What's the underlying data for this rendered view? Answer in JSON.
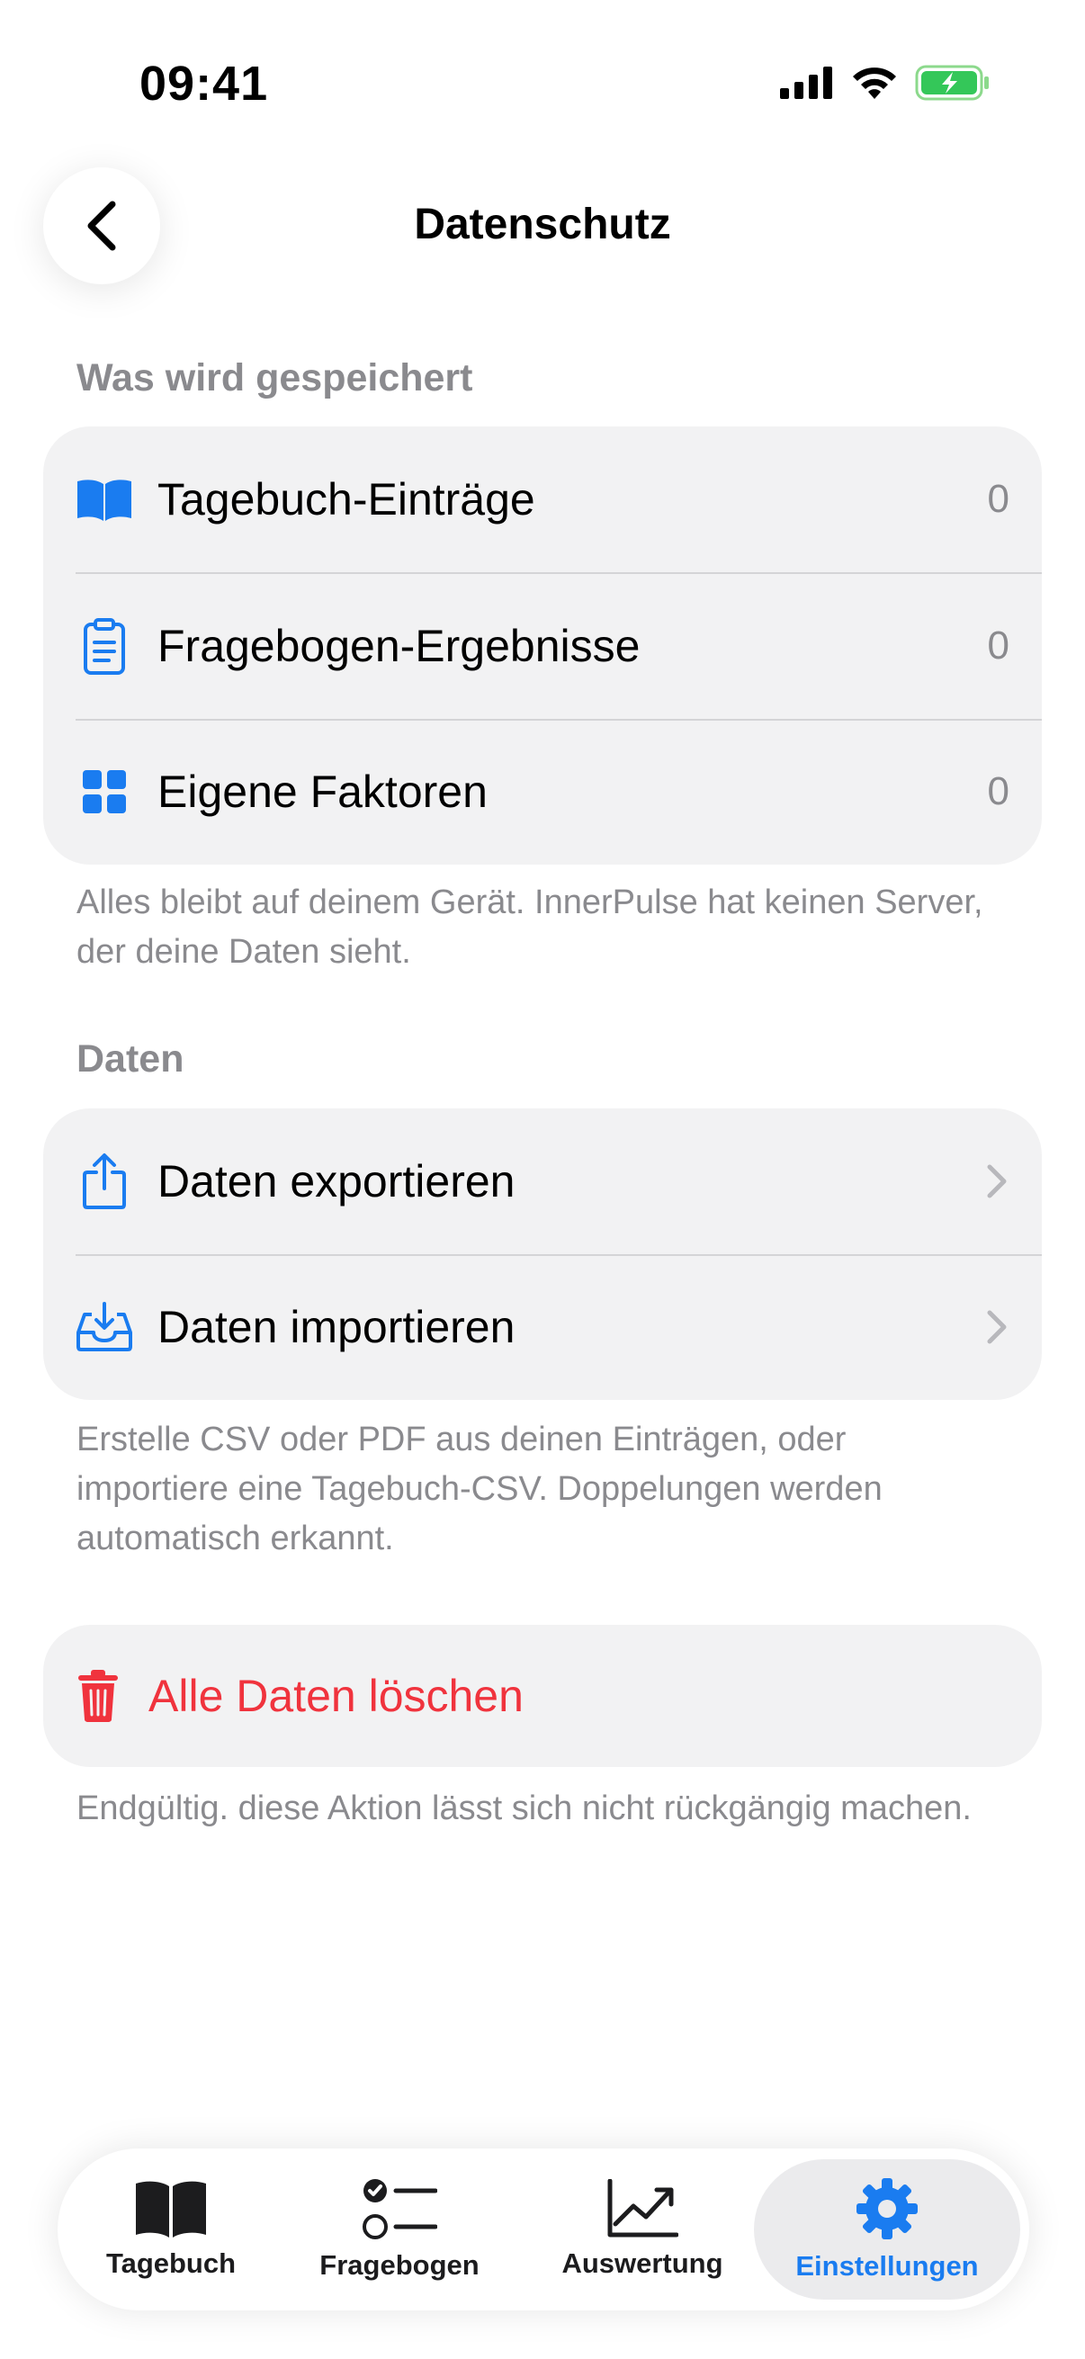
{
  "status": {
    "time": "09:41"
  },
  "nav": {
    "title": "Datenschutz"
  },
  "storage": {
    "header": "Was wird gespeichert",
    "items": [
      {
        "label": "Tagebuch-Einträge",
        "value": "0",
        "icon": "book-open-icon"
      },
      {
        "label": "Fragebogen-Ergebnisse",
        "value": "0",
        "icon": "clipboard-icon"
      },
      {
        "label": "Eigene Faktoren",
        "value": "0",
        "icon": "grid-icon"
      }
    ],
    "footnote": "Alles bleibt auf deinem Gerät. InnerPulse hat keinen Server, der deine Daten sieht."
  },
  "data": {
    "header": "Daten",
    "items": [
      {
        "label": "Daten exportieren",
        "icon": "share-icon"
      },
      {
        "label": "Daten importieren",
        "icon": "inbox-download-icon"
      }
    ],
    "footnote": "Erstelle CSV oder PDF aus deinen Einträgen, oder importiere eine Tagebuch-CSV. Doppelungen werden automatisch erkannt."
  },
  "danger": {
    "label": "Alle Daten löschen",
    "footnote": "Endgültig. diese Aktion lässt sich nicht rückgängig machen."
  },
  "tabs": [
    {
      "label": "Tagebuch",
      "icon": "book-icon"
    },
    {
      "label": "Fragebogen",
      "icon": "checklist-icon"
    },
    {
      "label": "Auswertung",
      "icon": "chart-trend-icon"
    },
    {
      "label": "Einstellungen",
      "icon": "gear-icon",
      "active": true
    }
  ],
  "colors": {
    "accent": "#1a7cf0",
    "destructive": "#f0333d",
    "secondary_text": "#8a8a8e",
    "card_bg": "#f2f2f3"
  }
}
